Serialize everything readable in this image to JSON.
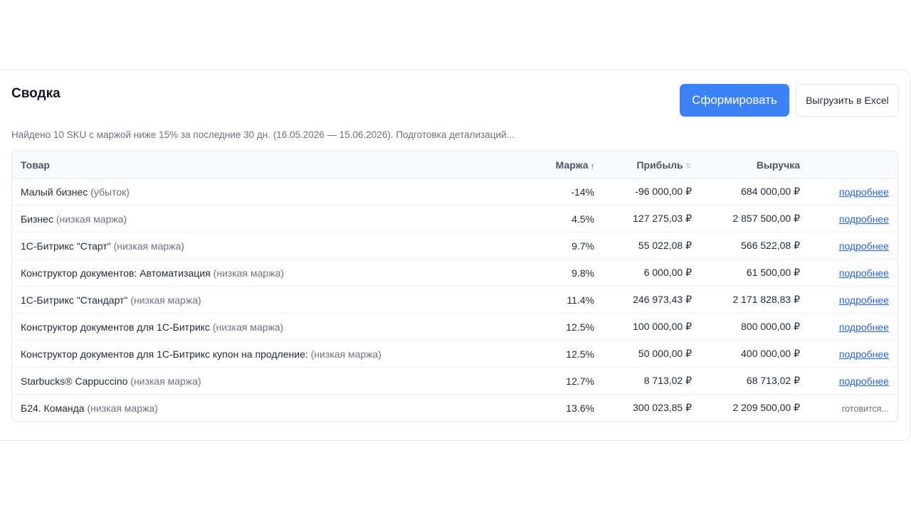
{
  "summary": {
    "title": "Сводка",
    "generate_label": "Сформировать",
    "export_label": "Выгрузить в Excel",
    "status_text": "Найдено 10 SKU с маржой ниже 15% за последние 30 дн. (16.05.2026 — 15.06.2026). Подготовка детализаций..."
  },
  "table": {
    "headers": {
      "product": "Товар",
      "margin": "Маржа",
      "margin_sort_icon": "↑",
      "profit": "Прибыль",
      "profit_sort_icon": "⇅",
      "revenue": "Выручка"
    },
    "rows": [
      {
        "name": "Малый бизнес",
        "tag": "(убыток)",
        "margin": "-14%",
        "profit": "-96 000,00 ₽",
        "revenue": "684 000,00 ₽",
        "action": "подробнее",
        "action_type": "link"
      },
      {
        "name": "Бизнес",
        "tag": "(низкая маржа)",
        "margin": "4.5%",
        "profit": "127 275,03 ₽",
        "revenue": "2 857 500,00 ₽",
        "action": "подробнее",
        "action_type": "link"
      },
      {
        "name": "1С-Битрикс \"Старт\"",
        "tag": "(низкая маржа)",
        "margin": "9.7%",
        "profit": "55 022,08 ₽",
        "revenue": "566 522,08 ₽",
        "action": "подробнее",
        "action_type": "link"
      },
      {
        "name": "Конструктор документов: Автоматизация",
        "tag": "(низкая маржа)",
        "margin": "9.8%",
        "profit": "6 000,00 ₽",
        "revenue": "61 500,00 ₽",
        "action": "подробнее",
        "action_type": "link"
      },
      {
        "name": "1С-Битрикс \"Стандарт\"",
        "tag": "(низкая маржа)",
        "margin": "11.4%",
        "profit": "246 973,43 ₽",
        "revenue": "2 171 828,83 ₽",
        "action": "подробнее",
        "action_type": "link"
      },
      {
        "name": "Конструктор документов для 1С-Битрикс",
        "tag": "(низкая маржа)",
        "margin": "12.5%",
        "profit": "100 000,00 ₽",
        "revenue": "800 000,00 ₽",
        "action": "подробнее",
        "action_type": "link"
      },
      {
        "name": "Конструктор документов для 1С-Битрикс купон на продление:",
        "tag": "(низкая маржа)",
        "margin": "12.5%",
        "profit": "50 000,00 ₽",
        "revenue": "400 000,00 ₽",
        "action": "подробнее",
        "action_type": "link"
      },
      {
        "name": "Starbucks® Cappuccino",
        "tag": "(низкая маржа)",
        "margin": "12.7%",
        "profit": "8 713,02 ₽",
        "revenue": "68 713,02 ₽",
        "action": "подробнее",
        "action_type": "link"
      },
      {
        "name": "Б24. Команда",
        "tag": "(низкая маржа)",
        "margin": "13.6%",
        "profit": "300 023,85 ₽",
        "revenue": "2 209 500,00 ₽",
        "action": "готовится...",
        "action_type": "pending"
      }
    ]
  },
  "colors": {
    "accent": "#3b82f6",
    "link": "#2563eb",
    "muted_text": "#6b7280"
  }
}
